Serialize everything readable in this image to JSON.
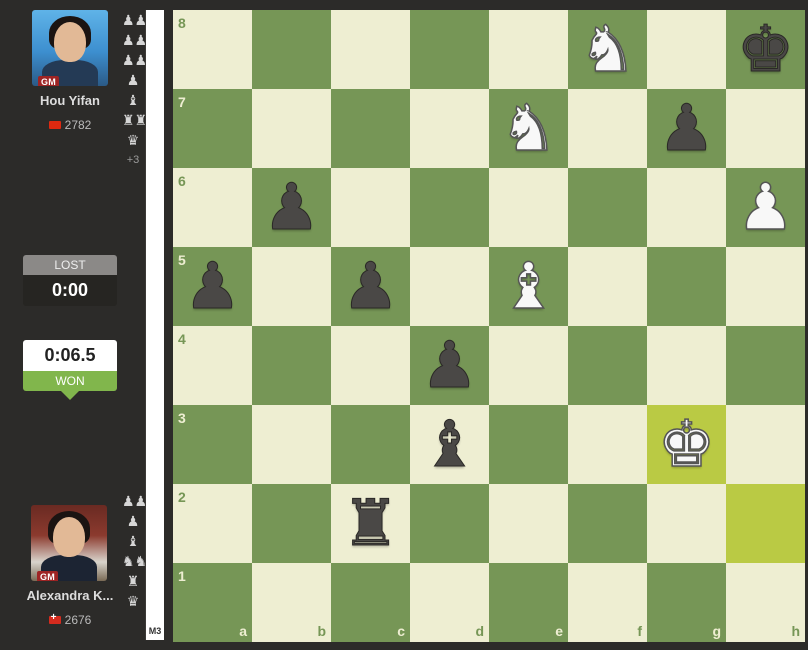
{
  "top_player": {
    "name": "Hou Yifan",
    "title": "GM",
    "rating": "2782",
    "flag": "cn",
    "captured": [
      "♟♟",
      "♟♟",
      "♟♟",
      "♟",
      "♝",
      "♜♜",
      "♛"
    ],
    "captured_extra": "+3"
  },
  "bottom_player": {
    "name": "Alexandra K...",
    "title": "GM",
    "rating": "2676",
    "flag": "ch",
    "captured": [
      "♟♟",
      "♟",
      "♝",
      "♞♞",
      "♜",
      "♛"
    ]
  },
  "clocks": {
    "top": {
      "label": "LOST",
      "time": "0:00"
    },
    "bottom": {
      "time": "0:06.5",
      "label": "WON"
    }
  },
  "eval": "M3",
  "colors": {
    "light": "#eeeed2",
    "dark": "#769656",
    "highlight": "#baca44",
    "won": "#81b64c"
  },
  "board": {
    "ranks": [
      "8",
      "7",
      "6",
      "5",
      "4",
      "3",
      "2",
      "1"
    ],
    "files": [
      "a",
      "b",
      "c",
      "d",
      "e",
      "f",
      "g",
      "h"
    ],
    "highlights": [
      "g3",
      "h2"
    ],
    "pieces": {
      "f8": {
        "glyph": "♞",
        "color": "w",
        "name": "white-knight"
      },
      "h8": {
        "glyph": "♚",
        "color": "b",
        "name": "black-king"
      },
      "e7": {
        "glyph": "♞",
        "color": "w",
        "name": "white-knight"
      },
      "g7": {
        "glyph": "♟",
        "color": "b",
        "name": "black-pawn"
      },
      "b6": {
        "glyph": "♟",
        "color": "b",
        "name": "black-pawn"
      },
      "h6": {
        "glyph": "♟",
        "color": "w",
        "name": "white-pawn"
      },
      "a5": {
        "glyph": "♟",
        "color": "b",
        "name": "black-pawn"
      },
      "c5": {
        "glyph": "♟",
        "color": "b",
        "name": "black-pawn"
      },
      "e5": {
        "glyph": "♝",
        "color": "w",
        "name": "white-bishop"
      },
      "d4": {
        "glyph": "♟",
        "color": "b",
        "name": "black-pawn"
      },
      "d3": {
        "glyph": "♝",
        "color": "b",
        "name": "black-bishop"
      },
      "g3": {
        "glyph": "♚",
        "color": "w",
        "name": "white-king"
      },
      "c2": {
        "glyph": "♜",
        "color": "b",
        "name": "black-rook"
      }
    }
  }
}
